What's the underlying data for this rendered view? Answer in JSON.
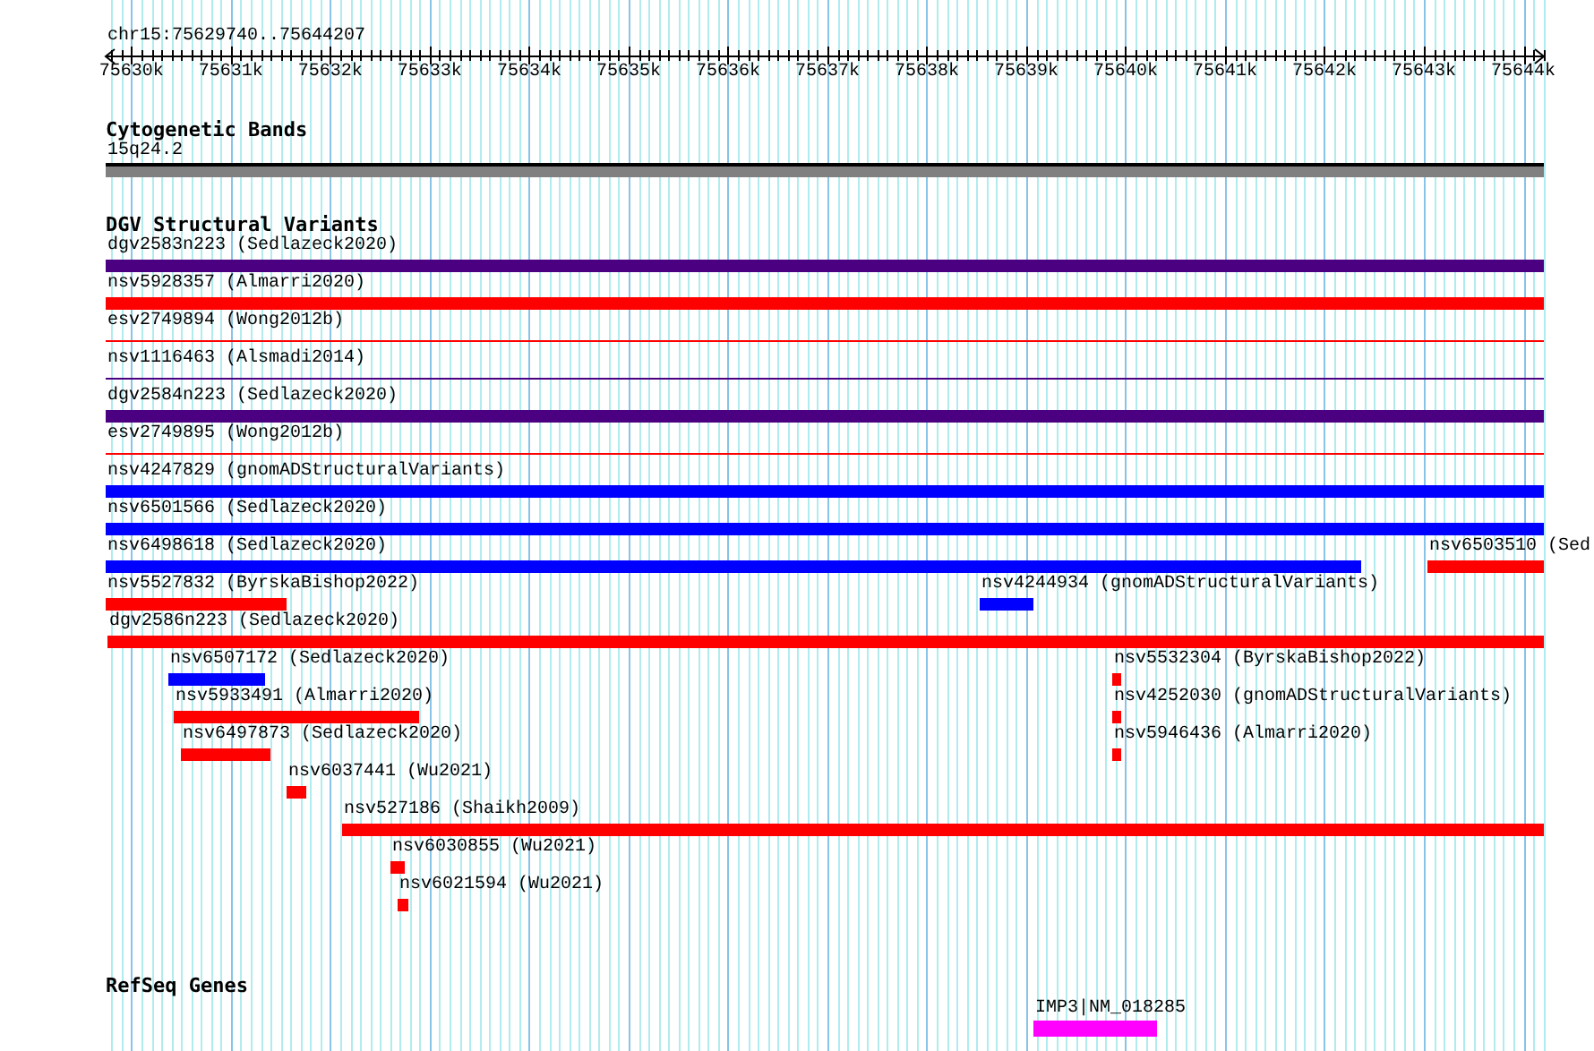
{
  "ruler": {
    "title": "chr15:75629740..75644207",
    "ticks": [
      "75630k",
      "75631k",
      "75632k",
      "75633k",
      "75634k",
      "75635k",
      "75636k",
      "75637k",
      "75638k",
      "75639k",
      "75640k",
      "75641k",
      "75642k",
      "75643k",
      "75644k"
    ]
  },
  "cytoband_track": {
    "title": "Cytogenetic Bands",
    "band": "15q24.2"
  },
  "dgv_track": {
    "title": "DGV Structural Variants",
    "rows": [
      {
        "features": [
          {
            "label": "dgv2583n223 (Sedlazeck2020)",
            "kind": "bar",
            "color": "#4b0082"
          }
        ]
      },
      {
        "features": [
          {
            "label": "nsv5928357 (Almarri2020)",
            "kind": "bar",
            "color": "#ff0000"
          }
        ]
      },
      {
        "features": [
          {
            "label": "esv2749894 (Wong2012b)",
            "kind": "line",
            "color": "#ff0000"
          }
        ]
      },
      {
        "features": [
          {
            "label": "nsv1116463 (Alsmadi2014)",
            "kind": "line",
            "color": "#4b0082"
          }
        ]
      },
      {
        "features": [
          {
            "label": "dgv2584n223 (Sedlazeck2020)",
            "kind": "bar",
            "color": "#4b0082"
          }
        ]
      },
      {
        "features": [
          {
            "label": "esv2749895 (Wong2012b)",
            "kind": "line",
            "color": "#ff0000"
          }
        ]
      },
      {
        "features": [
          {
            "label": "nsv4247829 (gnomADStructuralVariants)",
            "kind": "bar",
            "color": "#0000ff"
          }
        ]
      },
      {
        "features": [
          {
            "label": "nsv6501566 (Sedlazeck2020)",
            "kind": "bar",
            "color": "#0000ff"
          }
        ]
      },
      {
        "features": [
          {
            "label": "nsv6498618 (Sedlazeck2020)",
            "kind": "bar",
            "color": "#0000ff"
          },
          {
            "label": "nsv6503510 (Sed",
            "kind": "bar",
            "color": "#ff0000"
          }
        ]
      },
      {
        "features": [
          {
            "label": "nsv5527832 (ByrskaBishop2022)",
            "kind": "bar",
            "color": "#ff0000"
          },
          {
            "label": "nsv4244934 (gnomADStructuralVariants)",
            "kind": "bar",
            "color": "#0000ff"
          }
        ]
      },
      {
        "features": [
          {
            "label": "dgv2586n223 (Sedlazeck2020)",
            "kind": "bar",
            "color": "#ff0000"
          }
        ]
      },
      {
        "features": [
          {
            "label": "nsv6507172 (Sedlazeck2020)",
            "kind": "bar",
            "color": "#0000ff"
          },
          {
            "label": "nsv5532304 (ByrskaBishop2022)",
            "kind": "bar",
            "color": "#ff0000"
          }
        ]
      },
      {
        "features": [
          {
            "label": "nsv5933491 (Almarri2020)",
            "kind": "bar",
            "color": "#ff0000"
          },
          {
            "label": "nsv4252030 (gnomADStructuralVariants)",
            "kind": "bar",
            "color": "#ff0000"
          }
        ]
      },
      {
        "features": [
          {
            "label": "nsv6497873 (Sedlazeck2020)",
            "kind": "bar",
            "color": "#ff0000"
          },
          {
            "label": "nsv5946436 (Almarri2020)",
            "kind": "bar",
            "color": "#ff0000"
          }
        ]
      },
      {
        "features": [
          {
            "label": "nsv6037441 (Wu2021)",
            "kind": "bar",
            "color": "#ff0000"
          }
        ]
      },
      {
        "features": [
          {
            "label": "nsv527186 (Shaikh2009)",
            "kind": "bar",
            "color": "#ff0000"
          }
        ]
      },
      {
        "features": [
          {
            "label": "nsv6030855 (Wu2021)",
            "kind": "bar",
            "color": "#ff0000"
          }
        ]
      },
      {
        "features": [
          {
            "label": "nsv6021594 (Wu2021)",
            "kind": "bar",
            "color": "#ff0000"
          }
        ]
      }
    ]
  },
  "refseq_track": {
    "title": "RefSeq Genes",
    "genes": [
      {
        "label": "IMP3|NM_018285",
        "color": "#ff00ff"
      }
    ]
  }
}
